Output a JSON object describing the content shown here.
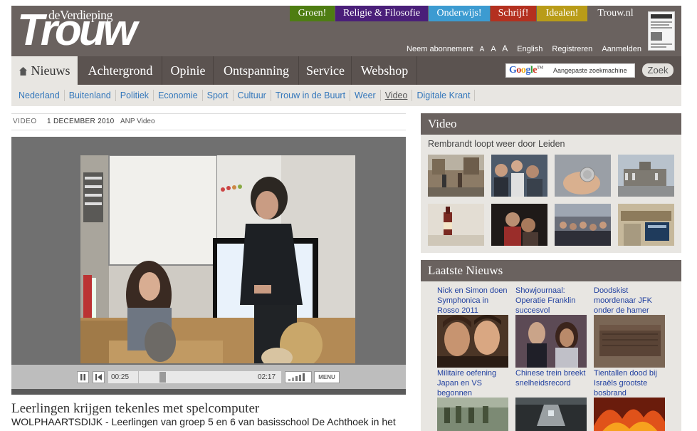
{
  "header": {
    "logo_sub": "deVerdieping",
    "logo_main": "Trouw",
    "categories": [
      "Groen!",
      "Religie & Filosofie",
      "Onderwijs!",
      "Schrijf!",
      "Idealen!",
      "Trouw.nl"
    ],
    "category_colors": [
      "#4e7d12",
      "#4a1f79",
      "#3c9bd1",
      "#b4301f",
      "#b99c18",
      "#6a625f"
    ],
    "util_links": [
      "Neem abonnement",
      "A",
      "A",
      "A",
      "English",
      "Registreren",
      "Aanmelden"
    ]
  },
  "nav": {
    "items": [
      "Nieuws",
      "Achtergrond",
      "Opinie",
      "Ontspanning",
      "Service",
      "Webshop"
    ],
    "active": "Nieuws",
    "search": {
      "brand": "Google",
      "brand_tm": "TM",
      "placeholder": "Aangepaste zoekmachine",
      "button": "Zoek"
    }
  },
  "subnav": {
    "items": [
      "Nederland",
      "Buitenland",
      "Politiek",
      "Economie",
      "Sport",
      "Cultuur",
      "Trouw in de Buurt",
      "Weer",
      "Video",
      "Digitale Krant"
    ],
    "current": "Video"
  },
  "article": {
    "type": "VIDEO",
    "date": "1 DECEMBER 2010",
    "source": "ANP Video",
    "headline": "Leerlingen krijgen tekenles met spelcomputer",
    "lead": "WOLPHAARTSDIJK - Leerlingen van groep 5 en 6 van basisschool De Achthoek in het"
  },
  "player": {
    "current_time": "00:25",
    "total_time": "02:17",
    "progress": 0.18,
    "menu_label": "MENU"
  },
  "sidebar": {
    "video_title": "Video",
    "video_featured": "Rembrandt loopt weer door Leiden",
    "news_title": "Laatste Nieuws",
    "news": [
      {
        "title": "Nick en Simon doen Symphonica in Rosso 2011"
      },
      {
        "title": "Showjournaal: Operatie Franklin succesvol"
      },
      {
        "title": "Doodskist moordenaar JFK onder de hamer"
      },
      {
        "title": "Militaire oefening Japan en VS begonnen"
      },
      {
        "title": "Chinese trein breekt snelheidsrecord"
      },
      {
        "title": "Tientallen dood bij Israëls grootste bosbrand"
      }
    ]
  }
}
